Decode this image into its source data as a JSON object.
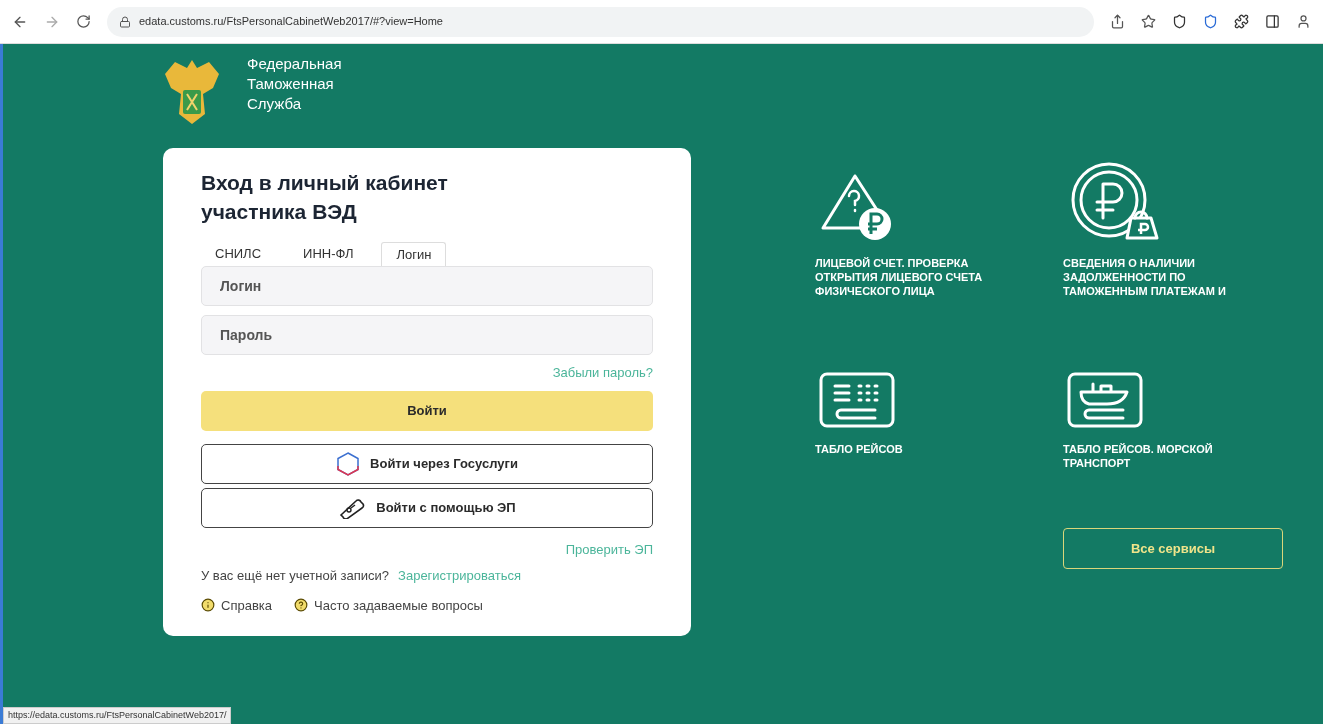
{
  "browser": {
    "url": "edata.customs.ru/FtsPersonalCabinetWeb2017/#?view=Home"
  },
  "logo": {
    "lines": [
      "Федеральная",
      "Таможенная",
      "Служба"
    ]
  },
  "login": {
    "title": "Вход в личный кабинет участника ВЭД",
    "tabs": [
      {
        "label": "СНИЛС",
        "selected": false
      },
      {
        "label": "ИНН-ФЛ",
        "selected": false
      },
      {
        "label": "Логин",
        "selected": true
      }
    ],
    "fields": [
      {
        "placeholder": "Логин"
      },
      {
        "placeholder": "Пароль"
      }
    ],
    "forgot": "Забыли пароль?",
    "submit": "Войти",
    "alt_buttons": [
      {
        "kind": "gosuslugi",
        "label": "Войти через Госуслуги"
      },
      {
        "kind": "token",
        "label": "Войти с помощью ЭП"
      }
    ],
    "check_sig": "Проверить ЭП",
    "register_prompt": "У вас ещё нет учетной записи?",
    "register_link": "Зарегистрироваться",
    "help_links": [
      {
        "kind": "info",
        "label": "Справка"
      },
      {
        "kind": "question",
        "label": "Часто задаваемые вопросы"
      }
    ]
  },
  "services": [
    {
      "kind": "warning-ruble",
      "label": "ЛИЦЕВОЙ СЧЕТ. ПРОВЕРКА ОТКРЫТИЯ ЛИЦЕВОГО СЧЕТА ФИЗИЧЕСКОГО ЛИЦА"
    },
    {
      "kind": "ruble-coin",
      "label": "СВЕДЕНИЯ О НАЛИЧИИ ЗАДОЛЖЕННОСТИ ПО ТАМОЖЕННЫМ ПЛАТЕЖАМ И"
    },
    {
      "kind": "board",
      "label": "ТАБЛО РЕЙСОВ"
    },
    {
      "kind": "ship-board",
      "label": "ТАБЛО РЕЙСОВ. МОРСКОЙ ТРАНСПОРТ"
    }
  ],
  "all_services": "Все сервисы",
  "status_url": "https://edata.customs.ru/FtsPersonalCabinetWeb2017/"
}
